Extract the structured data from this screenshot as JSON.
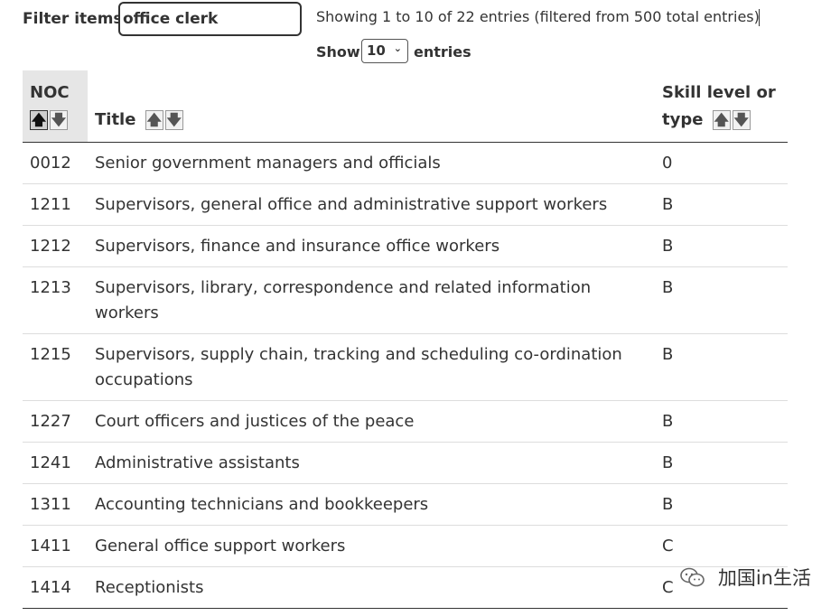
{
  "filter": {
    "label": "Filter items",
    "value": "office clerk"
  },
  "status": {
    "text": "Showing 1 to 10 of 22 entries (filtered from 500 total entries)"
  },
  "page_size": {
    "show_label": "Show",
    "selected": "10",
    "entries_label": "entries"
  },
  "table": {
    "headers": {
      "noc": "NOC",
      "title": "Title",
      "skill_line1": "Skill level or",
      "skill_line2": "type"
    },
    "sort_icons": {
      "asc": "up-arrow-icon",
      "desc": "down-arrow-icon"
    },
    "rows": [
      {
        "noc": "0012",
        "title": "Senior government managers and officials",
        "skill": "0"
      },
      {
        "noc": "1211",
        "title": "Supervisors, general office and administrative support workers",
        "skill": "B"
      },
      {
        "noc": "1212",
        "title": "Supervisors, finance and insurance office workers",
        "skill": "B"
      },
      {
        "noc": "1213",
        "title": "Supervisors, library, correspondence and related information workers",
        "skill": "B"
      },
      {
        "noc": "1215",
        "title": "Supervisors, supply chain, tracking and scheduling co-ordination occupations",
        "skill": "B"
      },
      {
        "noc": "1227",
        "title": "Court officers and justices of the peace",
        "skill": "B"
      },
      {
        "noc": "1241",
        "title": "Administrative assistants",
        "skill": "B"
      },
      {
        "noc": "1311",
        "title": "Accounting technicians and bookkeepers",
        "skill": "B"
      },
      {
        "noc": "1411",
        "title": "General office support workers",
        "skill": "C"
      },
      {
        "noc": "1414",
        "title": "Receptionists",
        "skill": "C"
      }
    ]
  },
  "watermark": {
    "text": "加国in生活",
    "icon": "wechat-icon"
  }
}
